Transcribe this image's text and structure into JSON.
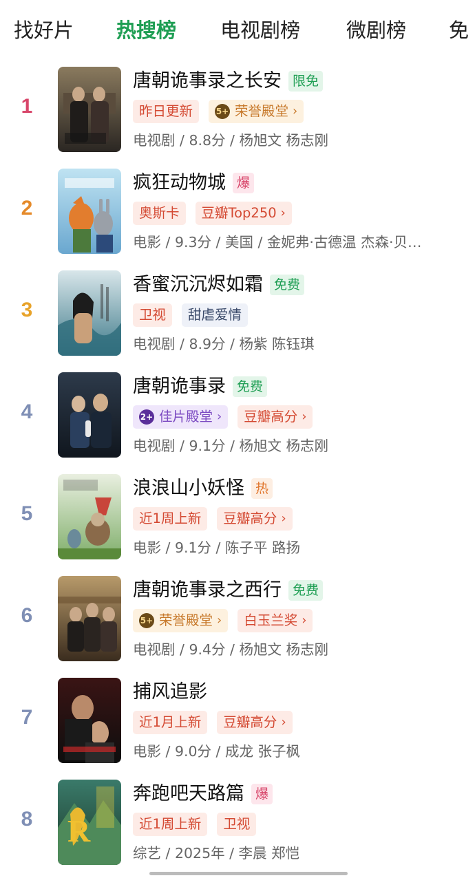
{
  "tabs": [
    "找好片",
    "热搜榜",
    "电视剧榜",
    "微剧榜",
    "免"
  ],
  "active_tab_index": 1,
  "colors": {
    "accent_green": "#1e9e53",
    "rank_1": "#d8466a",
    "rank_2": "#e58a2a",
    "rank_3": "#e8a32a",
    "rank_other": "#7f8fb5"
  },
  "items": [
    {
      "rank": "1",
      "title": "唐朝诡事录之长安",
      "badge": "限免",
      "tags": [
        {
          "label": "昨日更新"
        },
        {
          "label": "荣誉殿堂",
          "medal": "5+"
        }
      ],
      "meta": "电视剧 / 8.8分 / 杨旭文 杨志刚"
    },
    {
      "rank": "2",
      "title": "疯狂动物城",
      "badge": "爆",
      "tags": [
        {
          "label": "奥斯卡"
        },
        {
          "label": "豆瓣Top250"
        }
      ],
      "meta": "电影 / 9.3分 / 美国 / 金妮弗·古德温 杰森·贝…"
    },
    {
      "rank": "3",
      "title": "香蜜沉沉烬如霜",
      "badge": "免费",
      "tags": [
        {
          "label": "卫视"
        },
        {
          "label": "甜虐爱情"
        }
      ],
      "meta": "电视剧 / 8.9分 / 杨紫 陈钰琪"
    },
    {
      "rank": "4",
      "title": "唐朝诡事录",
      "badge": "免费",
      "tags": [
        {
          "label": "佳片殿堂",
          "medal": "2+"
        },
        {
          "label": "豆瓣高分"
        }
      ],
      "meta": "电视剧 / 9.1分 / 杨旭文 杨志刚"
    },
    {
      "rank": "5",
      "title": "浪浪山小妖怪",
      "badge": "热",
      "tags": [
        {
          "label": "近1周上新"
        },
        {
          "label": "豆瓣高分"
        }
      ],
      "meta": "电影 / 9.1分 / 陈子平 路扬"
    },
    {
      "rank": "6",
      "title": "唐朝诡事录之西行",
      "badge": "免费",
      "tags": [
        {
          "label": "荣誉殿堂",
          "medal": "5+"
        },
        {
          "label": "白玉兰奖"
        }
      ],
      "meta": "电视剧 / 9.4分 / 杨旭文 杨志刚"
    },
    {
      "rank": "7",
      "title": "捕风追影",
      "badge": "",
      "tags": [
        {
          "label": "近1月上新"
        },
        {
          "label": "豆瓣高分"
        }
      ],
      "meta": "电影 / 9.0分 / 成龙 张子枫"
    },
    {
      "rank": "8",
      "title": "奔跑吧天路篇",
      "badge": "爆",
      "tags": [
        {
          "label": "近1周上新"
        },
        {
          "label": "卫视"
        }
      ],
      "meta": "综艺 / 2025年 / 李晨 郑恺"
    }
  ]
}
